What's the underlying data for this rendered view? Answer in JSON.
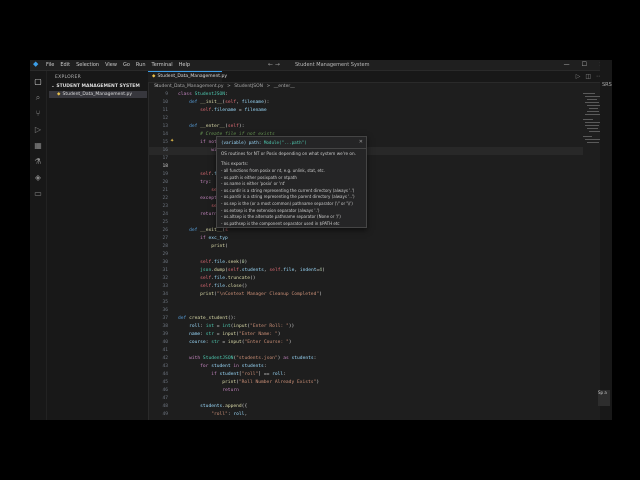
{
  "menu": [
    "File",
    "Edit",
    "Selection",
    "View",
    "Go",
    "Run",
    "Terminal",
    "Help"
  ],
  "window_title": "Student Management System",
  "nav_arrows": "← →",
  "window_controls": [
    "—",
    "☐",
    "✕"
  ],
  "sidebar": {
    "title": "EXPLORER",
    "folder": "STUDENT MANAGEMENT SYSTEM",
    "file": "Student_Data_Management.py"
  },
  "tab": {
    "label": "Student_Data_Management.py",
    "close": "×"
  },
  "breadcrumb": [
    "Student_Data_Management.py",
    ">",
    "StudentJSON",
    ">",
    "__enter__"
  ],
  "hover": {
    "signature_kw": "(variable) path:",
    "signature_type": "Module(\"...path\")",
    "description": "OS routines for NT or Posix depending on what system we're on.",
    "exports_title": "This exports:",
    "exports": [
      "- all functions from posix or nt, e.g. unlink, stat, etc.",
      "- os.path is either posixpath or ntpath",
      "- os.name is either 'posix' or 'nt'",
      "- os.curdir is a string representing the current directory (always '.')",
      "- os.pardir is a string representing the parent directory (always '..')",
      "- os.sep is the (or a most common) pathname separator ('/' or '\\\\')",
      "- os.extsep is the extension separator (always '.')",
      "- os.altsep is the alternate pathname separator (None or '/')",
      "- os.pathsep is the component separator used in $PATH etc",
      "- os.linesep is the line separator in text files ('\\r' or '\\n' or '\\r\\n')"
    ]
  },
  "right_labels": [
    "SRS"
  ],
  "notification": "Sp a"
}
